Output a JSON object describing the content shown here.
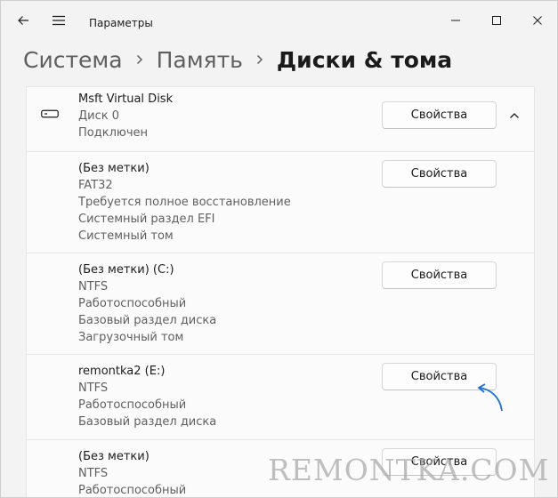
{
  "window": {
    "title": "Параметры",
    "accent": "#1f6fd1"
  },
  "breadcrumb": {
    "items": [
      "Система",
      "Память",
      "Диски & тома"
    ]
  },
  "disk": {
    "name": "Msft Virtual Disk",
    "number": "Диск 0",
    "status": "Подключен",
    "button_label": "Свойства",
    "icon": "disk-drive-icon",
    "expanded": true
  },
  "volumes": [
    {
      "label": "(Без метки)",
      "lines": [
        "FAT32",
        "Требуется полное восстановление",
        "Системный раздел EFI",
        "Системный том"
      ],
      "button_label": "Свойства"
    },
    {
      "label": "(Без метки) (C:)",
      "lines": [
        "NTFS",
        "Работоспособный",
        "Базовый раздел диска",
        "Загрузочный том"
      ],
      "button_label": "Свойства"
    },
    {
      "label": "remontka2 (E:)",
      "lines": [
        "NTFS",
        "Работоспособный",
        "Базовый раздел диска"
      ],
      "button_label": "Свойства"
    },
    {
      "label": "(Без метки)",
      "lines": [
        "NTFS",
        "Работоспособный"
      ],
      "button_label": "Свойства"
    }
  ],
  "watermark": "REMONTKA.COM"
}
